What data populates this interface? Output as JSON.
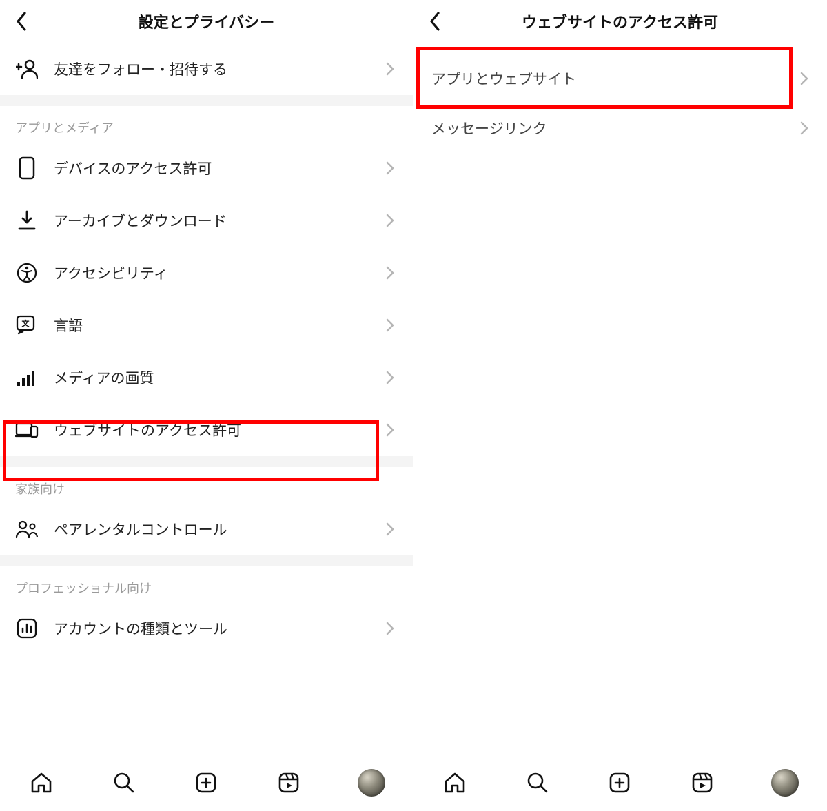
{
  "left": {
    "title": "設定とプライバシー",
    "top_row": {
      "label": "友達をフォロー・招待する"
    },
    "section1": {
      "header": "アプリとメディア",
      "items": [
        {
          "id": "device",
          "label": "デバイスのアクセス許可"
        },
        {
          "id": "archive",
          "label": "アーカイブとダウンロード"
        },
        {
          "id": "accessibility",
          "label": "アクセシビリティ"
        },
        {
          "id": "language",
          "label": "言語"
        },
        {
          "id": "media",
          "label": "メディアの画質"
        },
        {
          "id": "website",
          "label": "ウェブサイトのアクセス許可"
        }
      ]
    },
    "section2": {
      "header": "家族向け",
      "items": [
        {
          "id": "parental",
          "label": "ペアレンタルコントロール"
        }
      ]
    },
    "section3": {
      "header": "プロフェッショナル向け",
      "items": [
        {
          "id": "account-type",
          "label": "アカウントの種類とツール"
        }
      ]
    }
  },
  "right": {
    "title": "ウェブサイトのアクセス許可",
    "items": [
      {
        "id": "apps-websites",
        "label": "アプリとウェブサイト"
      },
      {
        "id": "message-links",
        "label": "メッセージリンク"
      }
    ]
  }
}
